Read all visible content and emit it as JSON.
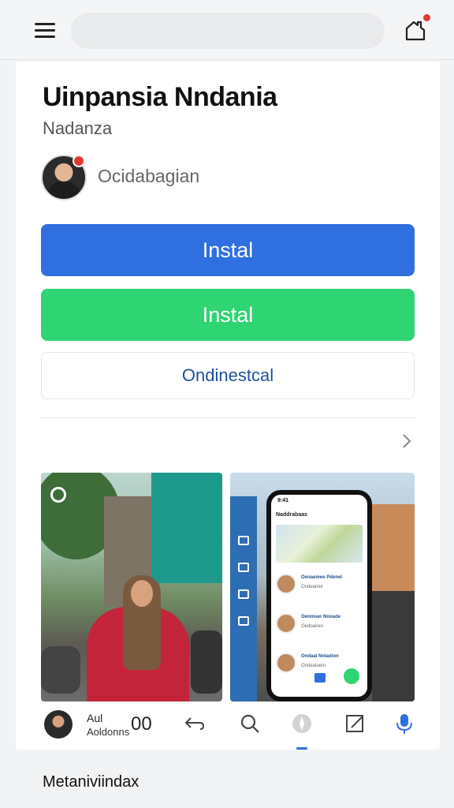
{
  "header": {
    "menu_icon": "hamburger-menu-icon",
    "search_placeholder": "",
    "notification_icon": "notification-icon",
    "accent": "#e53935"
  },
  "app": {
    "title": "Uinpansia Nndania",
    "subtitle": "Nadanza",
    "developer": "Ocidabagian"
  },
  "buttons": {
    "primary_label": "Instal",
    "primary_color": "#2f6fe0",
    "secondary_label": "Instal",
    "secondary_color": "#2fd473",
    "outline_label": "Ondinestcal"
  },
  "screenshots": [
    {
      "name": "photo-woman-street",
      "icon": "camera-icon"
    },
    {
      "name": "phone-app-preview",
      "phone": {
        "status": "9:41",
        "header": "Naddrabaas",
        "rows": [
          {
            "line1": "Oenaemeo Pdenel",
            "line2": "Ondeaniol"
          },
          {
            "line1": "Oenmuer Nnoade",
            "line2": "Oedoanen"
          },
          {
            "line1": "Ondaal Nnladion",
            "line2": "Ondealoem"
          }
        ]
      }
    }
  ],
  "bottom_nav": {
    "user_line1": "Aul",
    "user_line2": "Aoldonns",
    "count": "00",
    "items": [
      "back-arrow-icon",
      "search-icon",
      "compass-icon",
      "edit-icon",
      "microphone-icon"
    ]
  },
  "footer": {
    "label": "Metaniviindax"
  }
}
